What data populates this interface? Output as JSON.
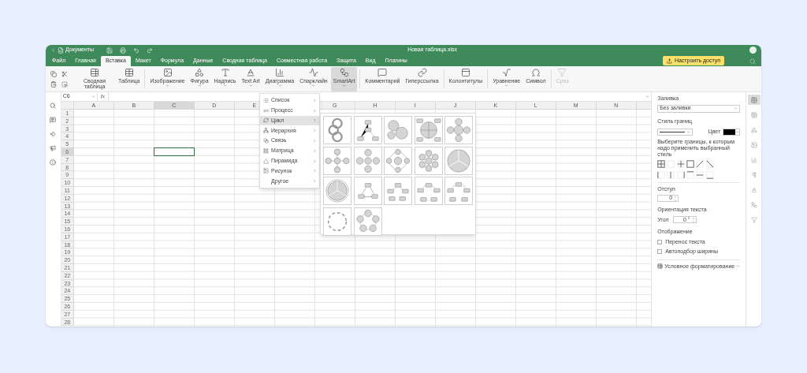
{
  "window": {
    "back_label": "Документы",
    "title": "Новая таблица.xlsx"
  },
  "tabs": [
    {
      "label": "Файл",
      "selected": false
    },
    {
      "label": "Главная",
      "selected": false
    },
    {
      "label": "Вставка",
      "selected": true
    },
    {
      "label": "Макет",
      "selected": false
    },
    {
      "label": "Формула",
      "selected": false
    },
    {
      "label": "Данные",
      "selected": false
    },
    {
      "label": "Сводная таблица",
      "selected": false
    },
    {
      "label": "Совместная работа",
      "selected": false
    },
    {
      "label": "Защита",
      "selected": false
    },
    {
      "label": "Вид",
      "selected": false
    },
    {
      "label": "Плагины",
      "selected": false
    }
  ],
  "share_button": {
    "label": "Настроить доступ"
  },
  "toolbar": {
    "groups": [
      [
        {
          "kind": "pivot",
          "label": "Сводная таблица",
          "dropdown": false,
          "selected": false,
          "disabled": false
        },
        {
          "kind": "table",
          "label": "Таблица",
          "dropdown": false,
          "selected": false,
          "disabled": false
        }
      ],
      [
        {
          "kind": "image",
          "label": "Изображение",
          "dropdown": true,
          "selected": false,
          "disabled": false
        },
        {
          "kind": "shape",
          "label": "Фигура",
          "dropdown": true,
          "selected": false,
          "disabled": false
        },
        {
          "kind": "textbox",
          "label": "Надпись",
          "dropdown": true,
          "selected": false,
          "disabled": false
        },
        {
          "kind": "textart",
          "label": "Text Art",
          "dropdown": true,
          "selected": false,
          "disabled": false
        },
        {
          "kind": "chart",
          "label": "Диаграмма",
          "dropdown": true,
          "selected": false,
          "disabled": false
        },
        {
          "kind": "sparkline",
          "label": "Спарклайн",
          "dropdown": true,
          "selected": false,
          "disabled": false
        },
        {
          "kind": "smartart",
          "label": "SmartArt",
          "dropdown": true,
          "selected": true,
          "disabled": false
        }
      ],
      [
        {
          "kind": "comment",
          "label": "Комментарий",
          "dropdown": false,
          "selected": false,
          "disabled": false
        },
        {
          "kind": "link",
          "label": "Гиперссылка",
          "dropdown": false,
          "selected": false,
          "disabled": false
        }
      ],
      [
        {
          "kind": "headerfooter",
          "label": "Колонтитулы",
          "dropdown": false,
          "selected": false,
          "disabled": false
        }
      ],
      [
        {
          "kind": "equation",
          "label": "Уравнение",
          "dropdown": true,
          "selected": false,
          "disabled": false
        },
        {
          "kind": "symbol",
          "label": "Символ",
          "dropdown": false,
          "selected": false,
          "disabled": false
        }
      ],
      [
        {
          "kind": "slicer",
          "label": "Срез",
          "dropdown": false,
          "selected": false,
          "disabled": true
        }
      ]
    ]
  },
  "formula_bar": {
    "cell_ref": "C6",
    "function_label": "fx"
  },
  "sheet": {
    "columns_left": [
      {
        "label": "A",
        "selected": false
      },
      {
        "label": "B",
        "selected": false
      },
      {
        "label": "C",
        "selected": true
      },
      {
        "label": "D",
        "selected": false
      },
      {
        "label": "E",
        "selected": false
      }
    ],
    "columns_right": [
      {
        "label": "G",
        "selected": false
      },
      {
        "label": "H",
        "selected": false
      },
      {
        "label": "I",
        "selected": false
      },
      {
        "label": "J",
        "selected": false
      },
      {
        "label": "K",
        "selected": false
      },
      {
        "label": "L",
        "selected": false
      },
      {
        "label": "M",
        "selected": false
      },
      {
        "label": "N",
        "selected": false
      }
    ],
    "rows": [
      {
        "label": "1",
        "selected": false
      },
      {
        "label": "2",
        "selected": false
      },
      {
        "label": "3",
        "selected": false
      },
      {
        "label": "4",
        "selected": false
      },
      {
        "label": "5",
        "selected": false
      },
      {
        "label": "6",
        "selected": true
      },
      {
        "label": "7",
        "selected": false
      },
      {
        "label": "8",
        "selected": false
      },
      {
        "label": "9",
        "selected": false
      },
      {
        "label": "10",
        "selected": false
      },
      {
        "label": "11",
        "selected": false
      },
      {
        "label": "12",
        "selected": false
      },
      {
        "label": "13",
        "selected": false
      },
      {
        "label": "14",
        "selected": false
      },
      {
        "label": "15",
        "selected": false
      },
      {
        "label": "16",
        "selected": false
      },
      {
        "label": "17",
        "selected": false
      },
      {
        "label": "18",
        "selected": false
      },
      {
        "label": "19",
        "selected": false
      },
      {
        "label": "20",
        "selected": false
      },
      {
        "label": "21",
        "selected": false
      },
      {
        "label": "22",
        "selected": false
      },
      {
        "label": "23",
        "selected": false
      },
      {
        "label": "24",
        "selected": false
      },
      {
        "label": "25",
        "selected": false
      },
      {
        "label": "26",
        "selected": false
      },
      {
        "label": "27",
        "selected": false
      },
      {
        "label": "28",
        "selected": false
      }
    ]
  },
  "smartart_menu": {
    "items": [
      {
        "kind": "list",
        "label": "Список",
        "selected": false
      },
      {
        "kind": "process",
        "label": "Процесс",
        "selected": false
      },
      {
        "kind": "cycle",
        "label": "Цикл",
        "selected": true
      },
      {
        "kind": "hierarchy",
        "label": "Иерархия",
        "selected": false
      },
      {
        "kind": "relation",
        "label": "Связь",
        "selected": false
      },
      {
        "kind": "matrix",
        "label": "Матрица",
        "selected": false
      },
      {
        "kind": "pyramid",
        "label": "Пирамида",
        "selected": false
      },
      {
        "kind": "picture",
        "label": "Рисунок",
        "selected": false
      },
      {
        "kind": "other",
        "label": "Другое",
        "selected": false
      }
    ]
  },
  "format_panel": {
    "fill": {
      "heading": "Заливка",
      "value": "Без заливки"
    },
    "border": {
      "heading": "Стиль границ",
      "color_label": "Цвет",
      "color": "#000000",
      "hint": "Выберите границы, к которым надо применить выбранный стиль"
    },
    "indent": {
      "heading": "Отступ",
      "value": "0"
    },
    "orientation": {
      "heading": "Ориентация текста",
      "angle_label": "Угол",
      "value": "0 °"
    },
    "display": {
      "heading": "Отображение",
      "options": [
        {
          "label": "Перенос текста",
          "checked": false
        },
        {
          "label": "Автоподбор ширины",
          "checked": false
        }
      ]
    },
    "conditional": {
      "label": "Условное форматирование"
    }
  },
  "right_strip": [
    {
      "kind": "cell",
      "selected": true
    },
    {
      "kind": "table",
      "selected": false
    },
    {
      "kind": "shape",
      "selected": false
    },
    {
      "kind": "image",
      "selected": false
    },
    {
      "kind": "chart",
      "selected": false
    },
    {
      "kind": "paragraph",
      "selected": false
    },
    {
      "kind": "textart",
      "selected": false
    },
    {
      "kind": "smartart",
      "selected": false
    },
    {
      "kind": "slicer",
      "selected": false
    }
  ]
}
